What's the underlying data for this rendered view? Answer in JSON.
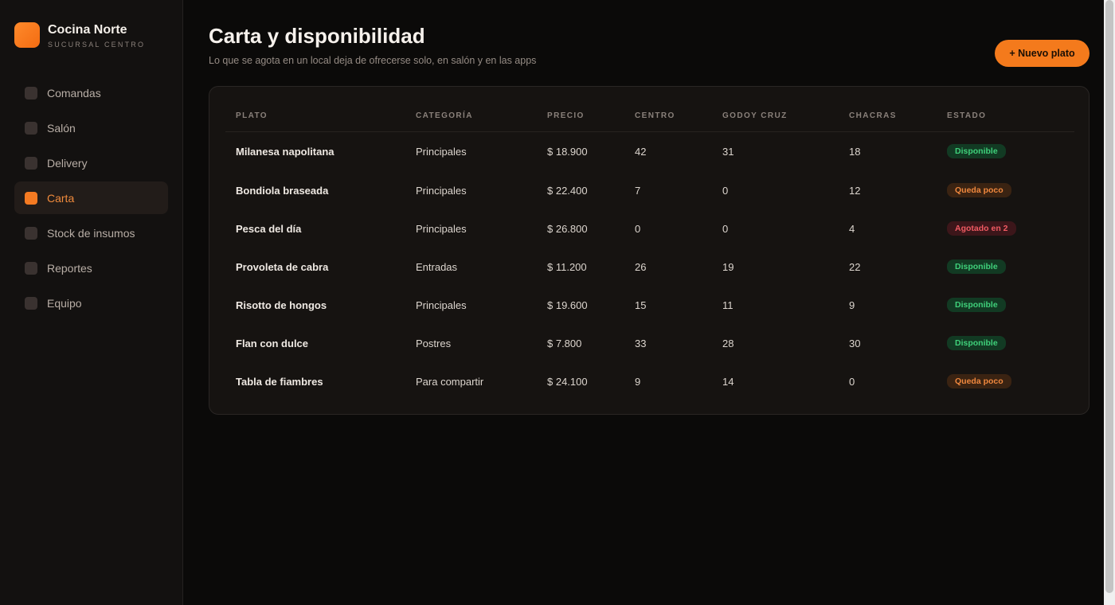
{
  "brand": {
    "name": "Cocina Norte",
    "subtitle": "SUCURSAL CENTRO",
    "logo_color": "#f47a1c"
  },
  "sidebar": {
    "items": [
      {
        "label": "Comandas",
        "active": false
      },
      {
        "label": "Salón",
        "active": false
      },
      {
        "label": "Delivery",
        "active": false
      },
      {
        "label": "Carta",
        "active": true
      },
      {
        "label": "Stock de insumos",
        "active": false
      },
      {
        "label": "Reportes",
        "active": false
      },
      {
        "label": "Equipo",
        "active": false
      }
    ]
  },
  "header": {
    "title": "Carta y disponibilidad",
    "subtitle": "Lo que se agota en un local deja de ofrecerse solo, en salón y en las apps",
    "new_button": "+ Nuevo plato"
  },
  "table": {
    "columns": [
      "PLATO",
      "CATEGORÍA",
      "PRECIO",
      "CENTRO",
      "GODOY CRUZ",
      "CHACRAS",
      "ESTADO"
    ],
    "rows": [
      {
        "plato": "Milanesa napolitana",
        "categoria": "Principales",
        "precio": "$ 18.900",
        "centro": "42",
        "godoy": "31",
        "chacras": "18",
        "estado": "Disponible",
        "estado_tipo": "ok"
      },
      {
        "plato": "Bondiola braseada",
        "categoria": "Principales",
        "precio": "$ 22.400",
        "centro": "7",
        "godoy": "0",
        "chacras": "12",
        "estado": "Queda poco",
        "estado_tipo": "low"
      },
      {
        "plato": "Pesca del día",
        "categoria": "Principales",
        "precio": "$ 26.800",
        "centro": "0",
        "godoy": "0",
        "chacras": "4",
        "estado": "Agotado en 2",
        "estado_tipo": "out"
      },
      {
        "plato": "Provoleta de cabra",
        "categoria": "Entradas",
        "precio": "$ 11.200",
        "centro": "26",
        "godoy": "19",
        "chacras": "22",
        "estado": "Disponible",
        "estado_tipo": "ok"
      },
      {
        "plato": "Risotto de hongos",
        "categoria": "Principales",
        "precio": "$ 19.600",
        "centro": "15",
        "godoy": "11",
        "chacras": "9",
        "estado": "Disponible",
        "estado_tipo": "ok"
      },
      {
        "plato": "Flan con dulce",
        "categoria": "Postres",
        "precio": "$ 7.800",
        "centro": "33",
        "godoy": "28",
        "chacras": "30",
        "estado": "Disponible",
        "estado_tipo": "ok"
      },
      {
        "plato": "Tabla de fiambres",
        "categoria": "Para compartir",
        "precio": "$ 24.100",
        "centro": "9",
        "godoy": "14",
        "chacras": "0",
        "estado": "Queda poco",
        "estado_tipo": "low"
      }
    ]
  },
  "colors": {
    "accent": "#f47a1c",
    "ok": "#3fd07a",
    "low": "#f0883e",
    "out": "#f05a62"
  }
}
